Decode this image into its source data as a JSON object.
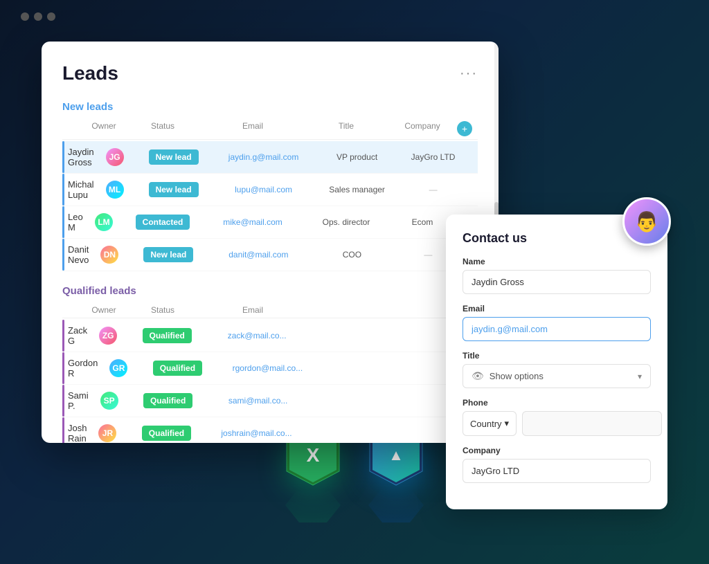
{
  "window": {
    "title": "Leads"
  },
  "header": {
    "title": "Leads",
    "more_label": "···"
  },
  "new_leads_section": {
    "title": "New leads",
    "columns": [
      "",
      "Owner",
      "Status",
      "Email",
      "Title",
      "Company",
      ""
    ],
    "rows": [
      {
        "name": "Jaydin Gross",
        "owner_initials": "JG",
        "avatar_class": "avatar-1",
        "status": "New lead",
        "status_class": "status-new-lead",
        "email": "jaydin.g@mail.com",
        "title": "VP product",
        "company": "JayGro LTD",
        "selected": true
      },
      {
        "name": "Michal Lupu",
        "owner_initials": "ML",
        "avatar_class": "avatar-2",
        "status": "New lead",
        "status_class": "status-new-lead",
        "email": "lupu@mail.com",
        "title": "Sales manager",
        "company": "—",
        "selected": false
      },
      {
        "name": "Leo M",
        "owner_initials": "LM",
        "avatar_class": "avatar-3",
        "status": "Contacted",
        "status_class": "status-contacted",
        "email": "mike@mail.com",
        "title": "Ops. director",
        "company": "Ecom",
        "selected": false
      },
      {
        "name": "Danit Nevo",
        "owner_initials": "DN",
        "avatar_class": "avatar-4",
        "status": "New lead",
        "status_class": "status-new-lead",
        "email": "danit@mail.com",
        "title": "COO",
        "company": "—",
        "selected": false
      }
    ]
  },
  "qualified_leads_section": {
    "title": "Qualified leads",
    "rows": [
      {
        "name": "Zack G",
        "owner_initials": "ZG",
        "avatar_class": "avatar-1",
        "status": "Qualified",
        "status_class": "status-qualified",
        "email": "zack@mail.co..."
      },
      {
        "name": "Gordon R",
        "owner_initials": "GR",
        "avatar_class": "avatar-2",
        "status": "Qualified",
        "status_class": "status-qualified",
        "email": "rgordon@mail.co..."
      },
      {
        "name": "Sami P.",
        "owner_initials": "SP",
        "avatar_class": "avatar-3",
        "status": "Qualified",
        "status_class": "status-qualified",
        "email": "sami@mail.co..."
      },
      {
        "name": "Josh Rain",
        "owner_initials": "JR",
        "avatar_class": "avatar-4",
        "status": "Qualified",
        "status_class": "status-qualified",
        "email": "joshrain@mail.co..."
      }
    ]
  },
  "contact_form": {
    "title": "Contact us",
    "name_label": "Name",
    "name_value": "Jaydin Gross",
    "email_label": "Email",
    "email_value": "jaydin.g@mail.com",
    "title_label": "Title",
    "title_placeholder": "Show options",
    "phone_label": "Phone",
    "country_label": "Country",
    "company_label": "Company",
    "company_value": "JayGro LTD"
  },
  "icons": {
    "more": "···",
    "add": "+",
    "eye": "👁",
    "chevron_down": "▾"
  }
}
